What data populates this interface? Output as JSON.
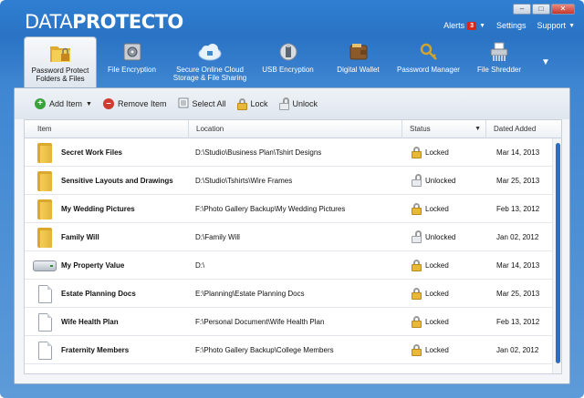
{
  "app": {
    "logo_part1": "DATA",
    "logo_part2": "PROTECTO"
  },
  "window_controls": {
    "minimize": "–",
    "maximize": "□",
    "close": "✕"
  },
  "top_menu": {
    "alerts_label": "Alerts",
    "alerts_count": "3",
    "settings_label": "Settings",
    "support_label": "Support"
  },
  "ribbon": {
    "tabs": [
      {
        "label1": "Password Protect",
        "label2": "Folders & Files",
        "icon": "folder-lock-icon",
        "active": true
      },
      {
        "label1": "File Encryption",
        "label2": "",
        "icon": "safe-icon"
      },
      {
        "label1": "Secure Online Cloud",
        "label2": "Storage & File Sharing",
        "icon": "cloud-icon"
      },
      {
        "label1": "USB Encryption",
        "label2": "",
        "icon": "usb-icon"
      },
      {
        "label1": "Digital Wallet",
        "label2": "",
        "icon": "wallet-icon"
      },
      {
        "label1": "Password Manager",
        "label2": "",
        "icon": "key-icon"
      },
      {
        "label1": "File Shredder",
        "label2": "",
        "icon": "shredder-icon"
      }
    ],
    "more": "▼"
  },
  "toolbar": {
    "add_label": "Add Item",
    "remove_label": "Remove Item",
    "select_all_label": "Select All",
    "lock_label": "Lock",
    "unlock_label": "Unlock"
  },
  "table": {
    "headers": {
      "item": "Item",
      "location": "Location",
      "status": "Status",
      "date": "Dated Added"
    },
    "rows": [
      {
        "type": "folder",
        "name": "Secret Work Files",
        "location": "D:\\Studio\\Business Plan\\Tshirt Designs",
        "status": "Locked",
        "locked": true,
        "date": "Mar 14, 2013"
      },
      {
        "type": "folder",
        "name": "Sensitive Layouts and Drawings",
        "location": "D:\\Studio\\Tshirts\\Wire Frames",
        "status": "Unlocked",
        "locked": false,
        "date": "Mar 25, 2013"
      },
      {
        "type": "folder",
        "name": "My Wedding Pictures",
        "location": "F:\\Photo Gallery Backup\\My Wedding Pictures",
        "status": "Locked",
        "locked": true,
        "date": "Feb 13, 2012"
      },
      {
        "type": "folder",
        "name": "Family Will",
        "location": "D:\\Family Will",
        "status": "Unlocked",
        "locked": false,
        "date": "Jan 02, 2012"
      },
      {
        "type": "drive",
        "name": "My Property Value",
        "location": "D:\\",
        "status": "Locked",
        "locked": true,
        "date": "Mar 14, 2013"
      },
      {
        "type": "doc",
        "name": "Estate Planning Docs",
        "location": "E:\\Planning\\Estate Planning Docs",
        "status": "Locked",
        "locked": true,
        "date": "Mar 25, 2013"
      },
      {
        "type": "doc",
        "name": "Wife Health Plan",
        "location": "F:\\Personal Document\\Wife Health Plan",
        "status": "Locked",
        "locked": true,
        "date": "Feb 13, 2012"
      },
      {
        "type": "doc",
        "name": "Fraternity Members",
        "location": "F:\\Photo Gallery Backup\\College Members",
        "status": "Locked",
        "locked": true,
        "date": "Jan 02, 2012"
      }
    ]
  },
  "colors": {
    "titlebar": "#2f7fd2",
    "accent": "#2a6fc4",
    "locked": "#e8b937"
  }
}
